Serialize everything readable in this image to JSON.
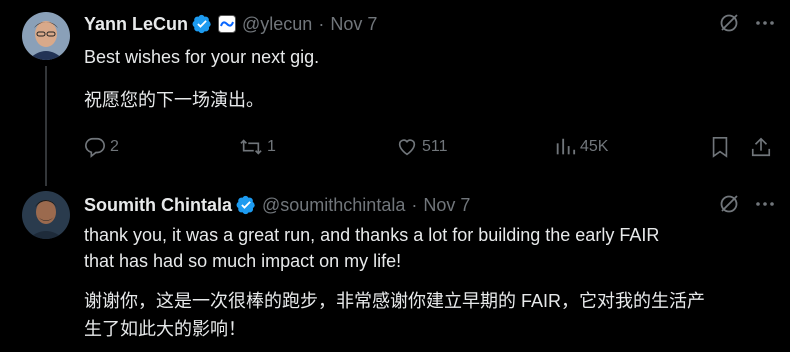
{
  "tweets": [
    {
      "author": {
        "name": "Yann LeCun",
        "handle": "@ylecun",
        "date": "Nov 7",
        "verified": true,
        "affiliation": "meta-logo"
      },
      "body": [
        "Best wishes for your next gig.",
        "祝愿您的下一场演出。"
      ],
      "actions": {
        "replies": "2",
        "reposts": "1",
        "likes": "511",
        "views": "45K"
      }
    },
    {
      "author": {
        "name": "Soumith Chintala",
        "handle": "@soumithchintala",
        "date": "Nov 7",
        "verified": true
      },
      "body": [
        "thank you, it was a great run, and thanks a lot for building the early FAIR",
        "that has had so much impact on my life!",
        "谢谢你，这是一次很棒的跑步，非常感谢你建立早期的 FAIR，它对我的生活产",
        "生了如此大的影响！"
      ]
    }
  ],
  "colors": {
    "background": "#000000",
    "text": "#e7e9ea",
    "muted": "#71767b",
    "verified": "#1d9bf0",
    "thread_line": "#333639"
  }
}
